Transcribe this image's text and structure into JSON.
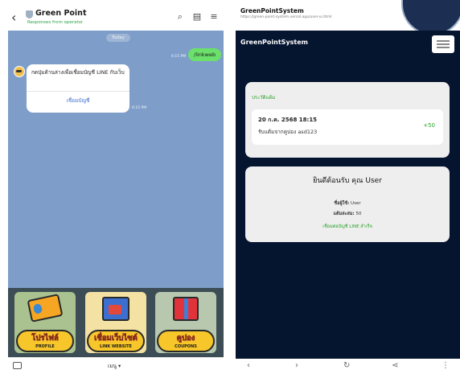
{
  "line_chat": {
    "header": {
      "title": "Green Point",
      "subtitle": "Responses from operator",
      "icons": [
        "back-icon",
        "shield-icon",
        "search-icon",
        "notes-icon",
        "menu-icon"
      ]
    },
    "messages": {
      "date_divider": "Today",
      "user_message": "/linkweb",
      "user_time": "6:15 PM",
      "bot_message": "กดปุ่มด้านล่างเพื่อเชื่อมบัญชี LINE กับเว็บ",
      "bot_button": "เชื่อมบัญชี",
      "bot_time": "6:15 PM"
    },
    "rich_menu": [
      {
        "label_th": "โปรไฟล์",
        "label_en": "PROFILE",
        "icon": "profile-card-icon"
      },
      {
        "label_th": "เชื่อมเว็บไซต์",
        "label_en": "LINK WEBSITE",
        "icon": "website-link-icon"
      },
      {
        "label_th": "คูปอง",
        "label_en": "COUPONS",
        "icon": "gift-icon"
      }
    ],
    "footer": {
      "menu_toggle": "เมนู ▾"
    }
  },
  "browser": {
    "tab_title": "GreenPointSystem",
    "url": "https://green-point-system.vercel.app/user-ui.html",
    "brand": "GreenPointSystem",
    "history": {
      "title": "ประวัติแต้ม",
      "item": {
        "date": "20 ก.ค. 2568 18:15",
        "description": "รับแต้มจากคูปอง asd123",
        "points": "+50"
      }
    },
    "welcome": {
      "title": "ยินดีต้อนรับ คุณ User",
      "username_label": "ชื่อผู้ใช้:",
      "username_value": "User",
      "points_label": "แต้มสะสม:",
      "points_value": "50",
      "linked_status": "เชื่อมต่อบัญชี LINE สำเร็จ"
    },
    "nav_icons": [
      "back-icon",
      "forward-icon",
      "reload-icon",
      "share-icon",
      "more-icon"
    ]
  },
  "colors": {
    "chat_bg": "#7e9ec9",
    "user_bubble": "#6be06b",
    "page_bg": "#05142f",
    "success_green": "#2aa12a"
  }
}
